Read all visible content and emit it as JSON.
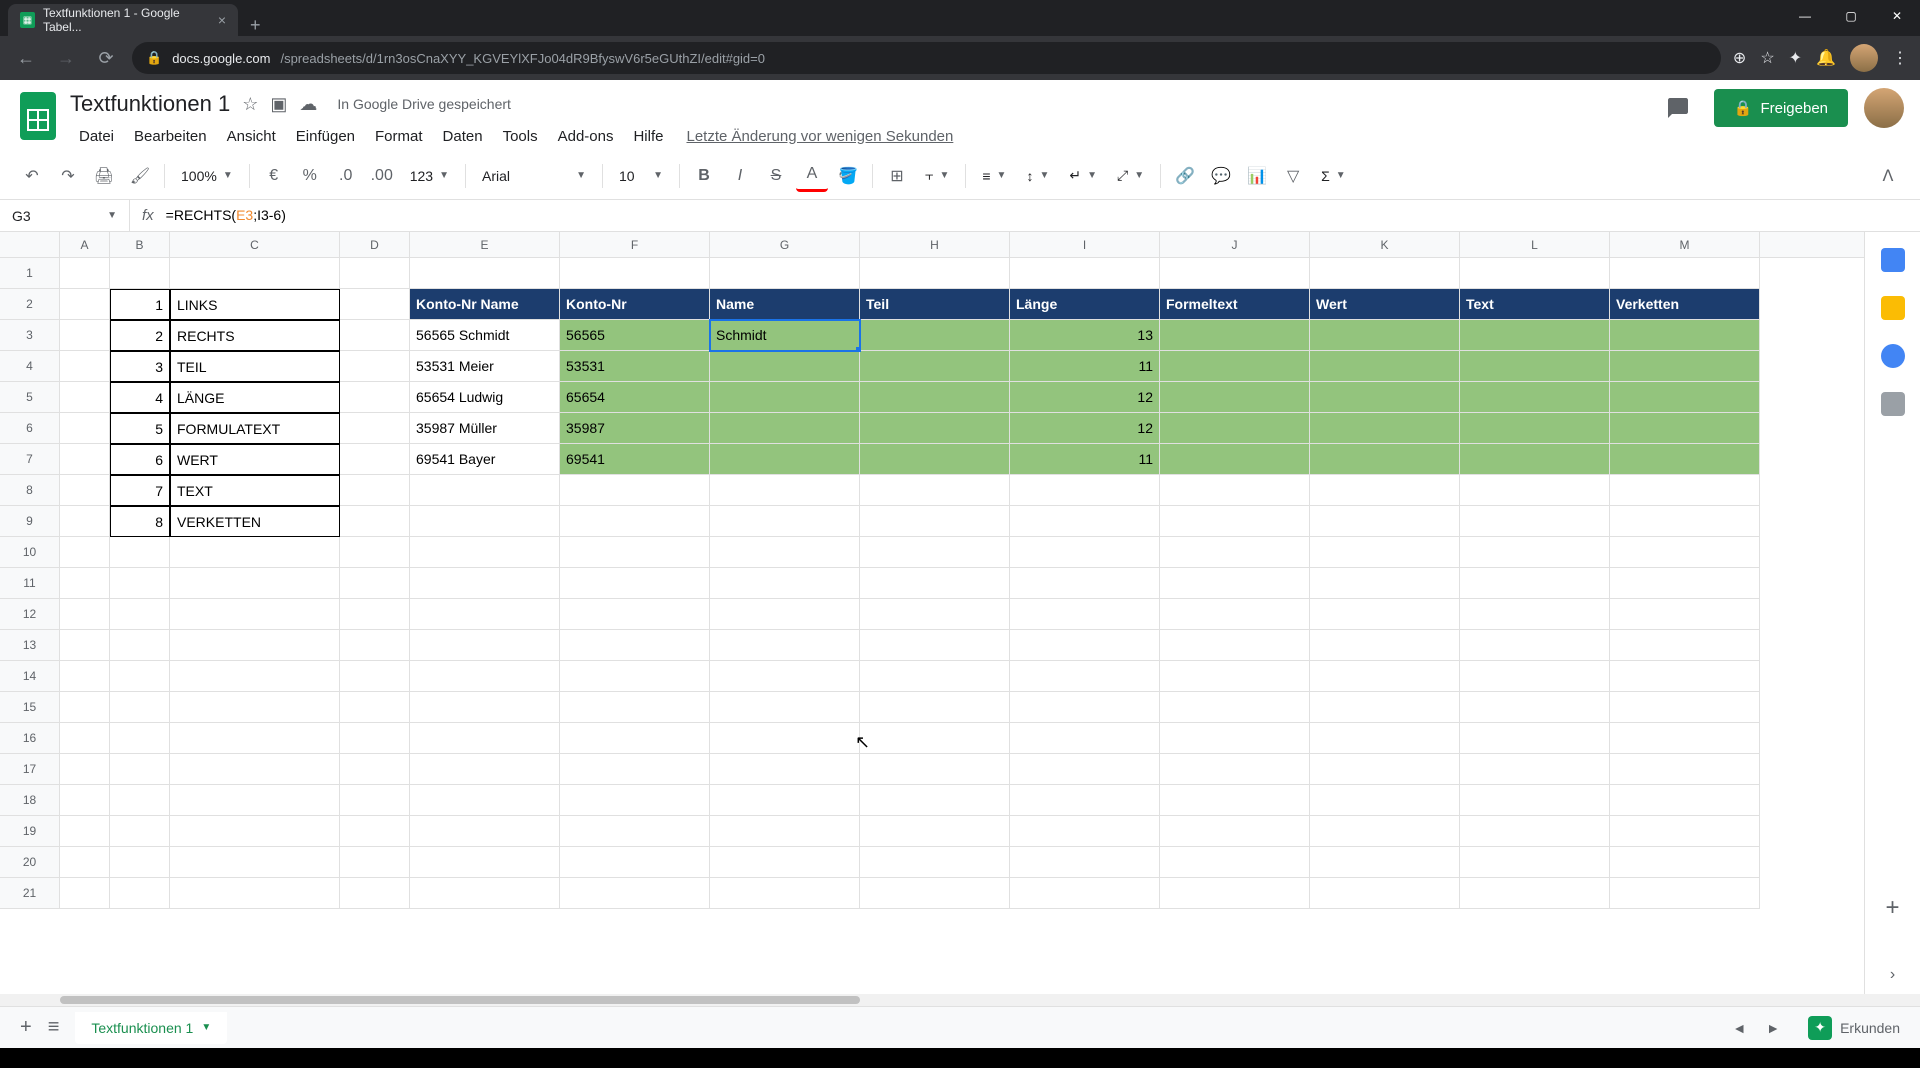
{
  "browser": {
    "tab_title": "Textfunktionen 1 - Google Tabel...",
    "url_prefix": "docs.google.com",
    "url_path": "/spreadsheets/d/1rn3osCnaXYY_KGVEYlXFJo04dR9BfyswV6r5eGUthZI/edit#gid=0"
  },
  "app": {
    "doc_title": "Textfunktionen 1",
    "save_status": "In Google Drive gespeichert",
    "last_edit": "Letzte Änderung vor wenigen Sekunden",
    "share_label": "Freigeben"
  },
  "menus": [
    "Datei",
    "Bearbeiten",
    "Ansicht",
    "Einfügen",
    "Format",
    "Daten",
    "Tools",
    "Add-ons",
    "Hilfe"
  ],
  "toolbar": {
    "zoom": "100%",
    "font": "Arial",
    "font_size": "10"
  },
  "formula_bar": {
    "cell_ref": "G3",
    "formula_prefix": "=RECHTS(",
    "formula_arg1": "E3",
    "formula_mid": ";I3-6)",
    "formula_full": "=RECHTS(E3;I3-6)"
  },
  "columns": [
    "A",
    "B",
    "C",
    "D",
    "E",
    "F",
    "G",
    "H",
    "I",
    "J",
    "K",
    "L",
    "M"
  ],
  "func_list": [
    {
      "n": "1",
      "name": "LINKS"
    },
    {
      "n": "2",
      "name": "RECHTS"
    },
    {
      "n": "3",
      "name": "TEIL"
    },
    {
      "n": "4",
      "name": "LÄNGE"
    },
    {
      "n": "5",
      "name": "FORMULATEXT"
    },
    {
      "n": "6",
      "name": "WERT"
    },
    {
      "n": "7",
      "name": "TEXT"
    },
    {
      "n": "8",
      "name": "VERKETTEN"
    }
  ],
  "table_headers": {
    "e": "Konto-Nr Name",
    "f": "Konto-Nr",
    "g": "Name",
    "h": "Teil",
    "i": "Länge",
    "j": "Formeltext",
    "k": "Wert",
    "l": "Text",
    "m": "Verketten"
  },
  "table_rows": [
    {
      "e": "56565 Schmidt",
      "f": "56565",
      "g": "Schmidt",
      "i": "13"
    },
    {
      "e": "53531 Meier",
      "f": "53531",
      "g": "",
      "i": "11"
    },
    {
      "e": "65654 Ludwig",
      "f": "65654",
      "g": "",
      "i": "12"
    },
    {
      "e": "35987 Müller",
      "f": "35987",
      "g": "",
      "i": "12"
    },
    {
      "e": "69541 Bayer",
      "f": "69541",
      "g": "",
      "i": "11"
    }
  ],
  "sheet_tab": "Textfunktionen 1",
  "explore_label": "Erkunden"
}
